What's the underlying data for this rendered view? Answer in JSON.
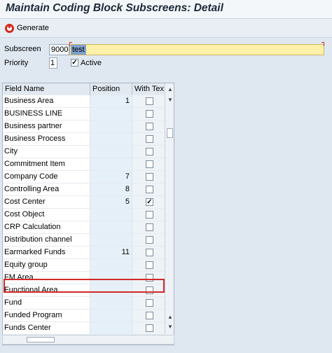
{
  "window": {
    "title": "Maintain Coding Block Subscreens: Detail"
  },
  "toolbar": {
    "generate_label": "Generate"
  },
  "form": {
    "subscreen_label": "Subscreen",
    "subscreen_id": "9000",
    "subscreen_value": "test",
    "priority_label": "Priority",
    "priority_value": "1",
    "active_label": "Active",
    "active_checked": true
  },
  "table": {
    "columns": [
      "Field Name",
      "Position",
      "With Tex"
    ],
    "rows": [
      {
        "name": "Business Area",
        "position": "1",
        "with_text": false
      },
      {
        "name": "BUSINESS LINE",
        "position": "",
        "with_text": false
      },
      {
        "name": "Business partner",
        "position": "",
        "with_text": false
      },
      {
        "name": "Business Process",
        "position": "",
        "with_text": false
      },
      {
        "name": "City",
        "position": "",
        "with_text": false
      },
      {
        "name": "Commitment Item",
        "position": "",
        "with_text": false
      },
      {
        "name": "Company Code",
        "position": "7",
        "with_text": false
      },
      {
        "name": "Controlling Area",
        "position": "8",
        "with_text": false
      },
      {
        "name": "Cost Center",
        "position": "5",
        "with_text": true
      },
      {
        "name": "Cost Object",
        "position": "",
        "with_text": false
      },
      {
        "name": "CRP Calculation",
        "position": "",
        "with_text": false
      },
      {
        "name": "Distribution channel",
        "position": "",
        "with_text": false
      },
      {
        "name": "Earmarked Funds",
        "position": "11",
        "with_text": false
      },
      {
        "name": "Equity group",
        "position": "",
        "with_text": false
      },
      {
        "name": "FM Area",
        "position": "",
        "with_text": false
      },
      {
        "name": "Functional Area",
        "position": "",
        "with_text": false
      },
      {
        "name": "Fund",
        "position": "",
        "with_text": false
      },
      {
        "name": "Funded Program",
        "position": "",
        "with_text": false
      },
      {
        "name": "Funds Center",
        "position": "",
        "with_text": false
      }
    ]
  },
  "colors": {
    "highlight": "#d12a2a",
    "input_bg": "#fdf0a8",
    "selection": "#7fa0cc"
  }
}
